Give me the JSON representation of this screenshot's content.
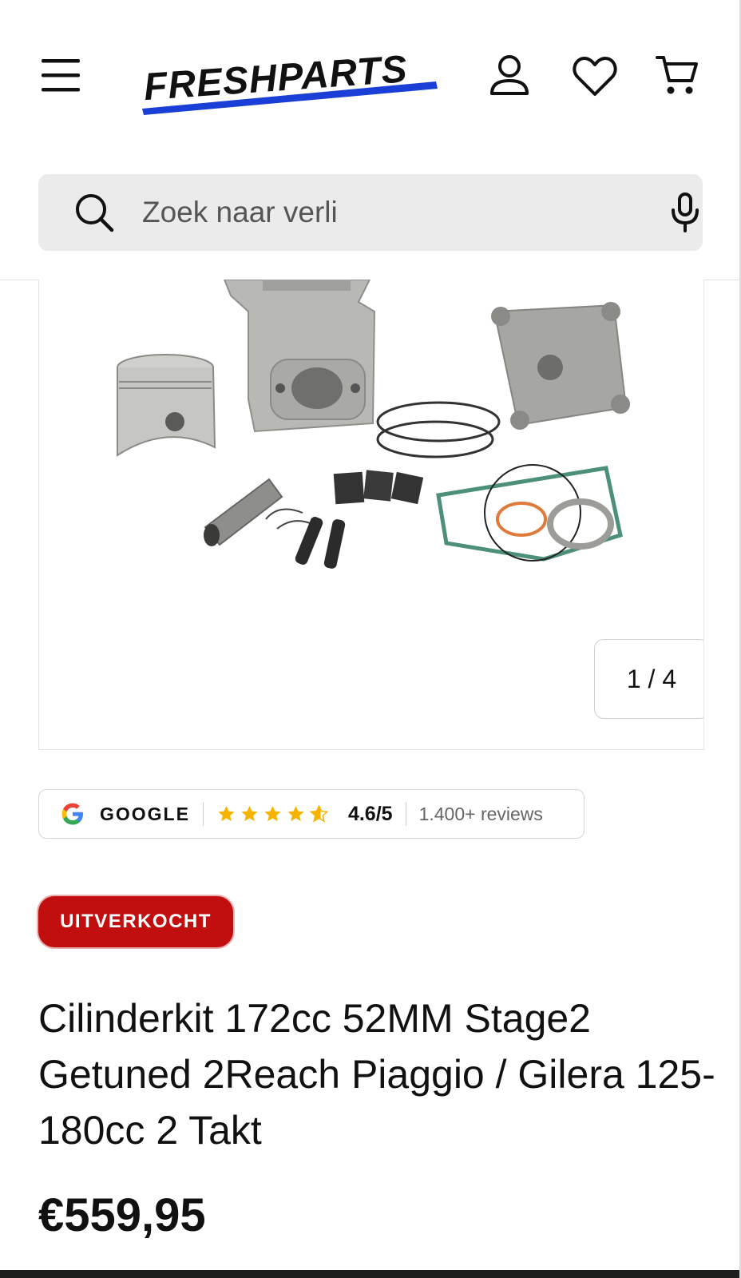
{
  "header": {
    "logo_text": "FRESHPARTS",
    "brand_color": "#1a3fd6",
    "menu_icon": "hamburger-menu-icon",
    "account_icon": "user-icon",
    "wishlist_icon": "heart-icon",
    "cart_icon": "cart-icon"
  },
  "search": {
    "value": "Zoek naar verli",
    "icon": "search-icon",
    "voice_icon": "microphone-icon"
  },
  "gallery": {
    "image_description": "product-photo-cylinder-kit",
    "counter": "1 / 4"
  },
  "reviews": {
    "provider": "GOOGLE",
    "rating": "4.6/5",
    "stars": 4.6,
    "count": "1.400+ reviews",
    "star_color": "#f6b400"
  },
  "product": {
    "status_badge": "UITVERKOCHT",
    "status_color": "#c10f0f",
    "title": "Cilinderkit 172cc 52MM Stage2 Getuned 2Reach Piaggio / Gilera 125-180cc 2 Takt",
    "price": "€559,95"
  }
}
